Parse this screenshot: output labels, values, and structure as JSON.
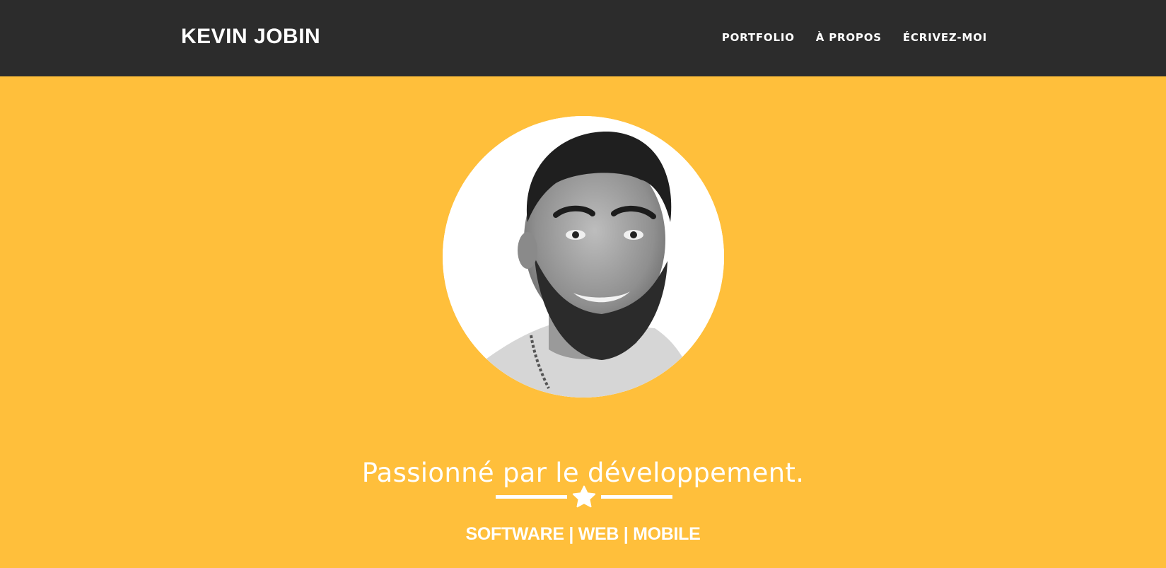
{
  "header": {
    "brand": "KEVIN JOBIN",
    "nav": [
      {
        "label": "PORTFOLIO"
      },
      {
        "label": "À PROPOS"
      },
      {
        "label": "ÉCRIVEZ-MOI"
      }
    ]
  },
  "hero": {
    "avatar_icon": "profile-photo",
    "headline": "Passionné par le développement.",
    "divider_icon": "star-icon",
    "tagline": "SOFTWARE | WEB | MOBILE"
  },
  "colors": {
    "navbar_bg": "#2c2c2c",
    "hero_bg": "#FFBF3B",
    "text": "#ffffff"
  }
}
